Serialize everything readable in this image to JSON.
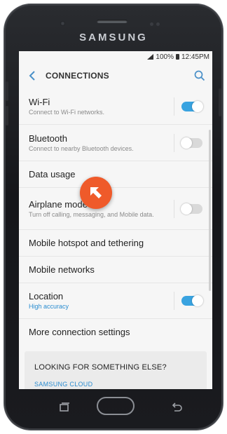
{
  "device": {
    "brand": "SAMSUNG"
  },
  "statusbar": {
    "battery_text": "100%",
    "time": "12:45PM"
  },
  "header": {
    "title": "CONNECTIONS",
    "back_icon": "chevron-left-icon",
    "search_icon": "search-icon"
  },
  "settings": [
    {
      "label": "Wi-Fi",
      "sub": "Connect to Wi-Fi networks.",
      "toggle": "on"
    },
    {
      "label": "Bluetooth",
      "sub": "Connect to nearby Bluetooth devices.",
      "toggle": "off"
    },
    {
      "label": "Data usage"
    },
    {
      "label": "Airplane mode",
      "sub": "Turn off calling, messaging, and Mobile data.",
      "toggle": "off"
    },
    {
      "label": "Mobile hotspot and tethering"
    },
    {
      "label": "Mobile networks"
    },
    {
      "label": "Location",
      "sub": "High accuracy",
      "toggle": "on"
    },
    {
      "label": "More connection settings"
    }
  ],
  "card": {
    "question": "LOOKING FOR SOMETHING ELSE?",
    "link": "SAMSUNG CLOUD"
  },
  "colors": {
    "accent": "#39a3e0",
    "link": "#2a8cd0",
    "pointer": "#ef5a2a"
  }
}
